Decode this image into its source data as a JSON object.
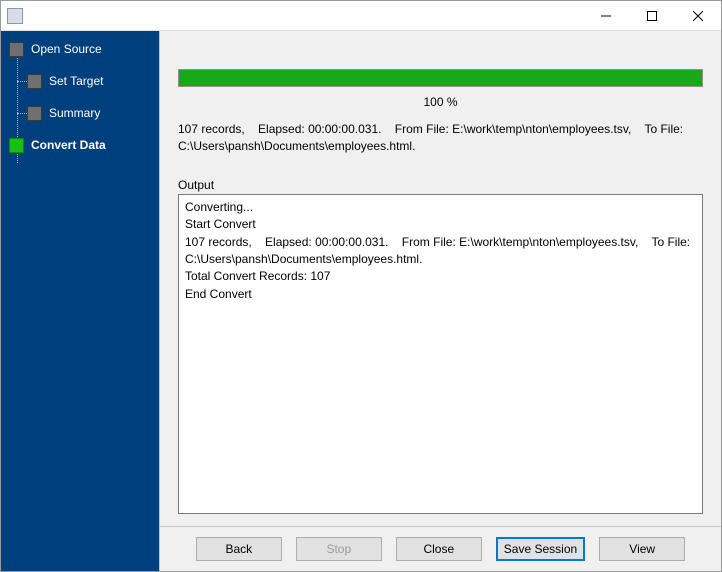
{
  "window": {
    "title": ""
  },
  "sidebar": {
    "items": [
      {
        "label": "Open Source"
      },
      {
        "label": "Set Target"
      },
      {
        "label": "Summary"
      },
      {
        "label": "Convert Data"
      }
    ]
  },
  "progress": {
    "percent_label": "100 %",
    "fill_percent": 100
  },
  "summary_text": "107 records,    Elapsed: 00:00:00.031.    From File: E:\\work\\temp\\nton\\employees.tsv,    To File: C:\\Users\\pansh\\Documents\\employees.html.",
  "output": {
    "label": "Output",
    "text": "Converting...\nStart Convert\n107 records,    Elapsed: 00:00:00.031.    From File: E:\\work\\temp\\nton\\employees.tsv,    To File: C:\\Users\\pansh\\Documents\\employees.html.\nTotal Convert Records: 107\nEnd Convert"
  },
  "buttons": {
    "back": "Back",
    "stop": "Stop",
    "close": "Close",
    "save_session": "Save Session",
    "view": "View"
  }
}
